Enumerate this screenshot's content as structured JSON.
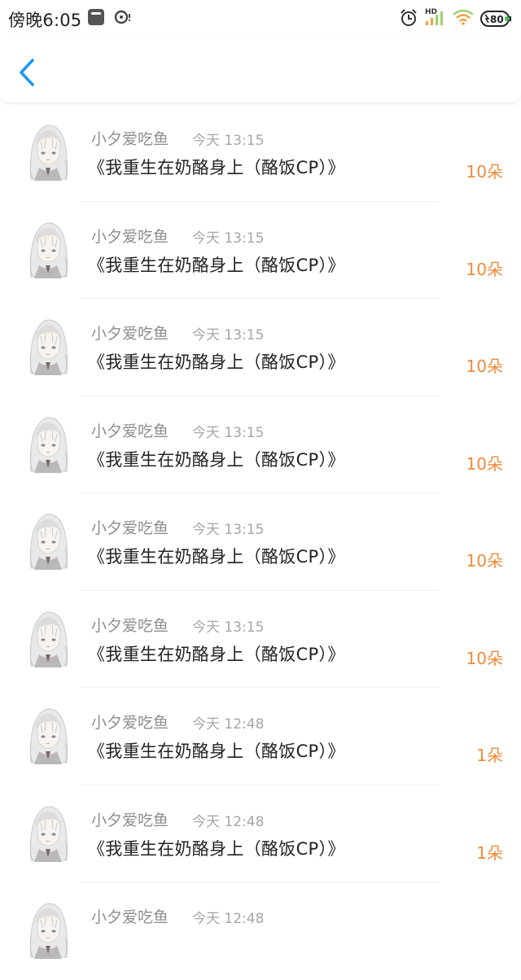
{
  "status_bar": {
    "time": "傍晚6:05",
    "network_label": "HD",
    "battery_level": "80",
    "icons": [
      "mi-icon",
      "sync-icon",
      "alarm-icon",
      "signal-icon",
      "wifi-icon",
      "battery-icon"
    ]
  },
  "header": {
    "back_icon": "chevron-left-icon",
    "accent_color": "#2196f3"
  },
  "records": [
    {
      "user": "小夕爱吃鱼",
      "time": "今天 13:15",
      "title": "《我重生在奶酪身上（酪饭CP）》",
      "count": "10朵"
    },
    {
      "user": "小夕爱吃鱼",
      "time": "今天 13:15",
      "title": "《我重生在奶酪身上（酪饭CP）》",
      "count": "10朵"
    },
    {
      "user": "小夕爱吃鱼",
      "time": "今天 13:15",
      "title": "《我重生在奶酪身上（酪饭CP）》",
      "count": "10朵"
    },
    {
      "user": "小夕爱吃鱼",
      "time": "今天 13:15",
      "title": "《我重生在奶酪身上（酪饭CP）》",
      "count": "10朵"
    },
    {
      "user": "小夕爱吃鱼",
      "time": "今天 13:15",
      "title": "《我重生在奶酪身上（酪饭CP）》",
      "count": "10朵"
    },
    {
      "user": "小夕爱吃鱼",
      "time": "今天 13:15",
      "title": "《我重生在奶酪身上（酪饭CP）》",
      "count": "10朵"
    },
    {
      "user": "小夕爱吃鱼",
      "time": "今天 12:48",
      "title": "《我重生在奶酪身上（酪饭CP）》",
      "count": "1朵"
    },
    {
      "user": "小夕爱吃鱼",
      "time": "今天 12:48",
      "title": "《我重生在奶酪身上（酪饭CP）》",
      "count": "1朵"
    },
    {
      "user": "小夕爱吃鱼",
      "time": "今天 12:48",
      "title": "",
      "count": ""
    }
  ],
  "colors": {
    "count": "#f08a3a",
    "meta": "#a6a6a6",
    "title": "#222222"
  }
}
